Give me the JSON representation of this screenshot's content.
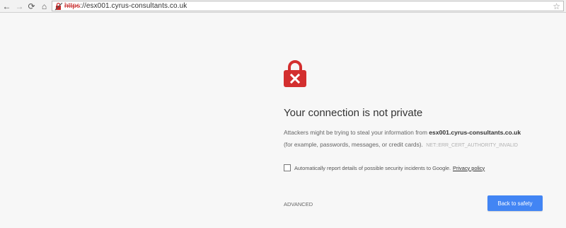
{
  "browser": {
    "nav": {
      "back_icon": "←",
      "forward_icon": "→",
      "reload_icon": "⟳",
      "home_icon": "⌂"
    },
    "omnibox": {
      "scheme": "https",
      "rest": "://esx001.cyrus-consultants.co.uk",
      "security_icon": "broken-lock-icon"
    },
    "bookmark_icon": "☆"
  },
  "interstitial": {
    "icon": "lock-error-icon",
    "heading": "Your connection is not private",
    "explanation": {
      "prefix": "Attackers might be trying to steal your information from ",
      "host": "esx001.cyrus-consultants.co.uk",
      "suffix": "(for example, passwords, messages, or credit cards).",
      "error_code": "NET::ERR_CERT_AUTHORITY_INVALID"
    },
    "report": {
      "checked": false,
      "label": "Automatically report details of possible security incidents to Google.",
      "privacy_link": "Privacy policy"
    },
    "advanced_label": "ADVANCED",
    "primary_button": "Back to safety"
  },
  "colors": {
    "background": "#f7f7f7",
    "lock_red": "#d32f2f",
    "primary_blue": "#4285f4",
    "url_scheme_red": "#c62828"
  }
}
